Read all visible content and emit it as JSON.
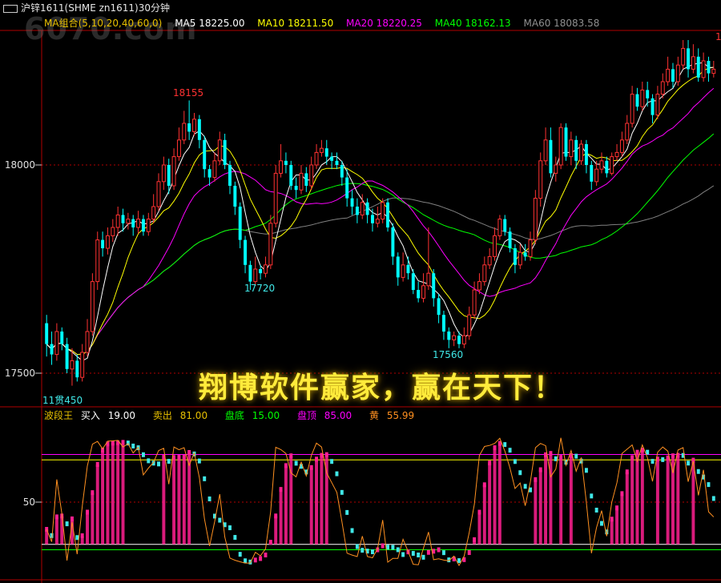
{
  "window": {
    "title": "沪锌1611(SHME zn1611)30分钟"
  },
  "watermark": "6070.com",
  "ma": {
    "group": "MA组合(5,10,20,40,60,0)",
    "ma5": "MA5 18225.00",
    "ma10": "MA10 18211.50",
    "ma20": "MA20 18220.25",
    "ma40": "MA40 18162.13",
    "ma60": "MA60 18083.58"
  },
  "axis": {
    "price_18000": "18000",
    "price_17500": "17500",
    "ind_50": "50"
  },
  "annotations": {
    "high_left": "18155",
    "low_1": "17720",
    "low_2": "17560",
    "low_start": "11贯450",
    "right_edge": "1"
  },
  "indicator": {
    "name": "波段王",
    "buy_label": "买入",
    "buy_value": "19.00",
    "sell_label": "卖出",
    "sell_value": "81.00",
    "bottom_label": "盘底",
    "bottom_value": "15.00",
    "top_label": "盘顶",
    "top_value": "85.00",
    "yellow_label": "黄",
    "yellow_value": "55.99"
  },
  "slogan": "翔博软件赢家，赢在天下！",
  "colors": {
    "up": "#ff3232",
    "down": "#00ffff",
    "ma5": "#ffffff",
    "ma10": "#ffff00",
    "ma20": "#ff00ff",
    "ma40": "#00ff00",
    "ma60": "#808080",
    "axis": "#b00000",
    "bar_up": "#ff2090",
    "bar_down": "#40e8e8",
    "yellow_line": "#ff9020"
  },
  "chart_data": {
    "type": "candlestick",
    "title": "沪锌1611(SHME zn1611)30分钟",
    "price_axis": {
      "ticks": [
        17500,
        18000
      ],
      "ylim": [
        17460,
        18310
      ]
    },
    "indicator_axis": {
      "ticks": [
        50
      ],
      "levels": {
        "buy": 19,
        "sell": 81,
        "bottom": 15,
        "top": 85
      }
    },
    "candles": [
      [
        17620,
        17570,
        17640,
        17540
      ],
      [
        17570,
        17545,
        17600,
        17520
      ],
      [
        17545,
        17600,
        17620,
        17530
      ],
      [
        17600,
        17570,
        17610,
        17555
      ],
      [
        17570,
        17510,
        17585,
        17500
      ],
      [
        17510,
        17530,
        17560,
        17470
      ],
      [
        17530,
        17490,
        17545,
        17480
      ],
      [
        17490,
        17550,
        17570,
        17480
      ],
      [
        17550,
        17600,
        17630,
        17540
      ],
      [
        17600,
        17720,
        17740,
        17590
      ],
      [
        17720,
        17820,
        17840,
        17700
      ],
      [
        17820,
        17800,
        17840,
        17780
      ],
      [
        17800,
        17830,
        17850,
        17785
      ],
      [
        17830,
        17850,
        17870,
        17815
      ],
      [
        17850,
        17880,
        17900,
        17830
      ],
      [
        17880,
        17860,
        17895,
        17840
      ],
      [
        17860,
        17870,
        17885,
        17845
      ],
      [
        17870,
        17850,
        17880,
        17830
      ],
      [
        17850,
        17870,
        17890,
        17835
      ],
      [
        17870,
        17840,
        17880,
        17830
      ],
      [
        17840,
        17870,
        17885,
        17830
      ],
      [
        17870,
        17900,
        17930,
        17860
      ],
      [
        17900,
        17960,
        17980,
        17890
      ],
      [
        17960,
        18000,
        18020,
        17940
      ],
      [
        18000,
        17950,
        18015,
        17930
      ],
      [
        17950,
        18020,
        18040,
        17940
      ],
      [
        18020,
        18060,
        18090,
        18010
      ],
      [
        18060,
        18100,
        18130,
        18050
      ],
      [
        18100,
        18080,
        18155,
        18060
      ],
      [
        18080,
        18110,
        18125,
        18070
      ],
      [
        18110,
        18060,
        18120,
        18040
      ],
      [
        18060,
        17990,
        18070,
        17970
      ],
      [
        17990,
        17970,
        18000,
        17950
      ],
      [
        17970,
        18010,
        18030,
        17960
      ],
      [
        18010,
        18060,
        18080,
        18000
      ],
      [
        18060,
        18000,
        18075,
        17990
      ],
      [
        18000,
        17950,
        18010,
        17930
      ],
      [
        17950,
        17900,
        17960,
        17880
      ],
      [
        17900,
        17820,
        17910,
        17800
      ],
      [
        17820,
        17760,
        17830,
        17740
      ],
      [
        17760,
        17720,
        17770,
        17700
      ],
      [
        17720,
        17750,
        17780,
        17710
      ],
      [
        17750,
        17740,
        17760,
        17725
      ],
      [
        17740,
        17760,
        17780,
        17730
      ],
      [
        17760,
        17860,
        17880,
        17750
      ],
      [
        17860,
        17980,
        18000,
        17850
      ],
      [
        17980,
        18010,
        18050,
        17970
      ],
      [
        18010,
        18000,
        18030,
        17980
      ],
      [
        18000,
        17950,
        18010,
        17940
      ],
      [
        17950,
        17940,
        17970,
        17920
      ],
      [
        17940,
        17980,
        18000,
        17930
      ],
      [
        17980,
        17950,
        17995,
        17935
      ],
      [
        17950,
        18000,
        18020,
        17940
      ],
      [
        18000,
        18030,
        18050,
        17990
      ],
      [
        18030,
        18040,
        18060,
        18020
      ],
      [
        18040,
        18020,
        18060,
        18000
      ],
      [
        18020,
        18010,
        18030,
        17990
      ],
      [
        18010,
        18000,
        18030,
        17990
      ],
      [
        18000,
        17970,
        18010,
        17950
      ],
      [
        17970,
        17920,
        17990,
        17900
      ],
      [
        17920,
        17900,
        17940,
        17880
      ],
      [
        17900,
        17880,
        17920,
        17860
      ],
      [
        17880,
        17910,
        17930,
        17870
      ],
      [
        17910,
        17880,
        17920,
        17860
      ],
      [
        17880,
        17860,
        17895,
        17840
      ],
      [
        17860,
        17870,
        17900,
        17850
      ],
      [
        17870,
        17910,
        17920,
        17860
      ],
      [
        17910,
        17850,
        17920,
        17840
      ],
      [
        17850,
        17780,
        17860,
        17760
      ],
      [
        17780,
        17730,
        17790,
        17710
      ],
      [
        17730,
        17760,
        17790,
        17720
      ],
      [
        17760,
        17740,
        17780,
        17725
      ],
      [
        17740,
        17700,
        17750,
        17690
      ],
      [
        17700,
        17680,
        17720,
        17670
      ],
      [
        17680,
        17710,
        17740,
        17670
      ],
      [
        17710,
        17740,
        17850,
        17700
      ],
      [
        17740,
        17680,
        17750,
        17660
      ],
      [
        17680,
        17640,
        17690,
        17620
      ],
      [
        17640,
        17600,
        17650,
        17580
      ],
      [
        17600,
        17580,
        17610,
        17560
      ],
      [
        17580,
        17590,
        17600,
        17565
      ],
      [
        17590,
        17570,
        17600,
        17560
      ],
      [
        17570,
        17590,
        17610,
        17560
      ],
      [
        17590,
        17640,
        17660,
        17580
      ],
      [
        17640,
        17700,
        17720,
        17630
      ],
      [
        17700,
        17720,
        17740,
        17690
      ],
      [
        17720,
        17760,
        17780,
        17710
      ],
      [
        17760,
        17780,
        17800,
        17750
      ],
      [
        17780,
        17830,
        17850,
        17770
      ],
      [
        17830,
        17870,
        17880,
        17820
      ],
      [
        17870,
        17840,
        17880,
        17830
      ],
      [
        17840,
        17800,
        17850,
        17790
      ],
      [
        17800,
        17760,
        17810,
        17740
      ],
      [
        17760,
        17790,
        17810,
        17750
      ],
      [
        17790,
        17780,
        17810,
        17770
      ],
      [
        17780,
        17820,
        17840,
        17770
      ],
      [
        17820,
        17920,
        17940,
        17810
      ],
      [
        17920,
        18010,
        18030,
        17900
      ],
      [
        18010,
        18060,
        18090,
        18000
      ],
      [
        18060,
        17980,
        18090,
        17970
      ],
      [
        17980,
        18000,
        18020,
        17960
      ],
      [
        18000,
        18090,
        18100,
        17990
      ],
      [
        18090,
        18020,
        18100,
        18010
      ],
      [
        18020,
        18060,
        18080,
        18000
      ],
      [
        18060,
        18010,
        18070,
        17990
      ],
      [
        18010,
        18050,
        18060,
        18000
      ],
      [
        18050,
        18000,
        18060,
        17980
      ],
      [
        18000,
        17960,
        18010,
        17940
      ],
      [
        17960,
        17990,
        18010,
        17950
      ],
      [
        17990,
        18010,
        18030,
        17980
      ],
      [
        18010,
        17980,
        18020,
        17970
      ],
      [
        17980,
        18020,
        18030,
        17975
      ],
      [
        18020,
        18030,
        18050,
        18010
      ],
      [
        18030,
        18060,
        18080,
        18020
      ],
      [
        18060,
        18100,
        18120,
        18050
      ],
      [
        18100,
        18170,
        18190,
        18090
      ],
      [
        18170,
        18140,
        18185,
        18130
      ],
      [
        18140,
        18180,
        18200,
        18130
      ],
      [
        18180,
        18160,
        18200,
        18140
      ],
      [
        18160,
        18120,
        18170,
        18100
      ],
      [
        18120,
        18170,
        18190,
        18110
      ],
      [
        18170,
        18200,
        18220,
        18160
      ],
      [
        18200,
        18230,
        18260,
        18190
      ],
      [
        18230,
        18200,
        18245,
        18185
      ],
      [
        18200,
        18240,
        18260,
        18190
      ],
      [
        18240,
        18280,
        18300,
        18230
      ],
      [
        18280,
        18230,
        18300,
        18210
      ],
      [
        18230,
        18260,
        18290,
        18220
      ],
      [
        18260,
        18210,
        18280,
        18200
      ],
      [
        18210,
        18250,
        18270,
        18200
      ],
      [
        18250,
        18220,
        18260,
        18200
      ],
      [
        18220,
        18230,
        18250,
        18210
      ]
    ]
  }
}
